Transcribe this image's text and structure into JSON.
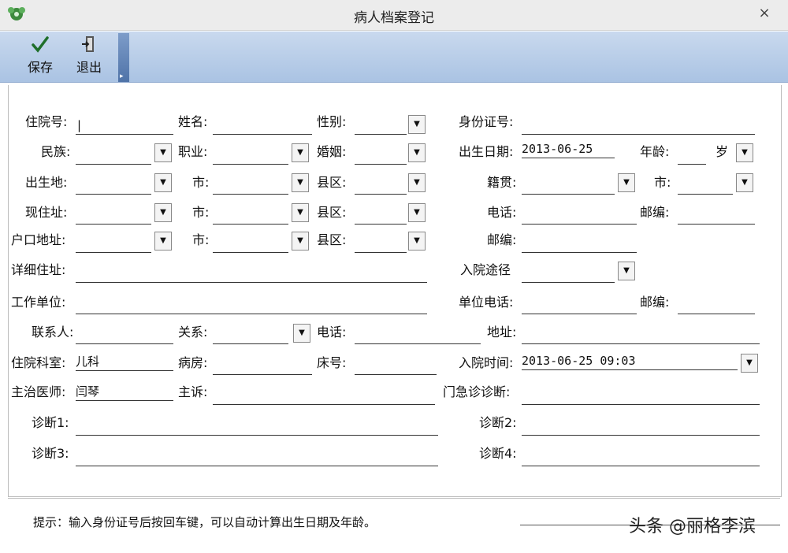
{
  "window": {
    "title": "病人档案登记",
    "close_label": "×"
  },
  "toolbar": {
    "save_label": "保存",
    "exit_label": "退出"
  },
  "form": {
    "admission_no_label": "住院号:",
    "name_label": "姓名:",
    "gender_label": "性别:",
    "id_card_label": "身份证号:",
    "ethnicity_label": "民族:",
    "occupation_label": "职业:",
    "marital_label": "婚姻:",
    "birth_date_label": "出生日期:",
    "birth_date_value": "2013-06-25",
    "age_label": "年龄:",
    "age_unit": "岁",
    "birthplace_label": "出生地:",
    "city_label": "市:",
    "county_label": "县区:",
    "native_place_label": "籍贯:",
    "current_address_label": "现住址:",
    "phone_label": "电话:",
    "postcode_label": "邮编:",
    "household_address_label": "户口地址:",
    "detailed_address_label": "详细住址:",
    "admission_route_label": "入院途径",
    "workplace_label": "工作单位:",
    "work_phone_label": "单位电话:",
    "contact_label": "联系人:",
    "relation_label": "关系:",
    "address_label": "地址:",
    "department_label": "住院科室:",
    "department_value": "儿科",
    "ward_label": "病房:",
    "bed_label": "床号:",
    "admission_time_label": "入院时间:",
    "admission_time_value": "2013-06-25 09:03",
    "doctor_label": "主治医师:",
    "doctor_value": "闫琴",
    "complaint_label": "主诉:",
    "er_diagnosis_label": "门急诊诊断:",
    "diagnosis1_label": "诊断1:",
    "diagnosis2_label": "诊断2:",
    "diagnosis3_label": "诊断3:",
    "diagnosis4_label": "诊断4:"
  },
  "hint": "提示：输入身份证号后按回车键，可以自动计算出生日期及年龄。",
  "watermark": "头条 @丽格李滨"
}
